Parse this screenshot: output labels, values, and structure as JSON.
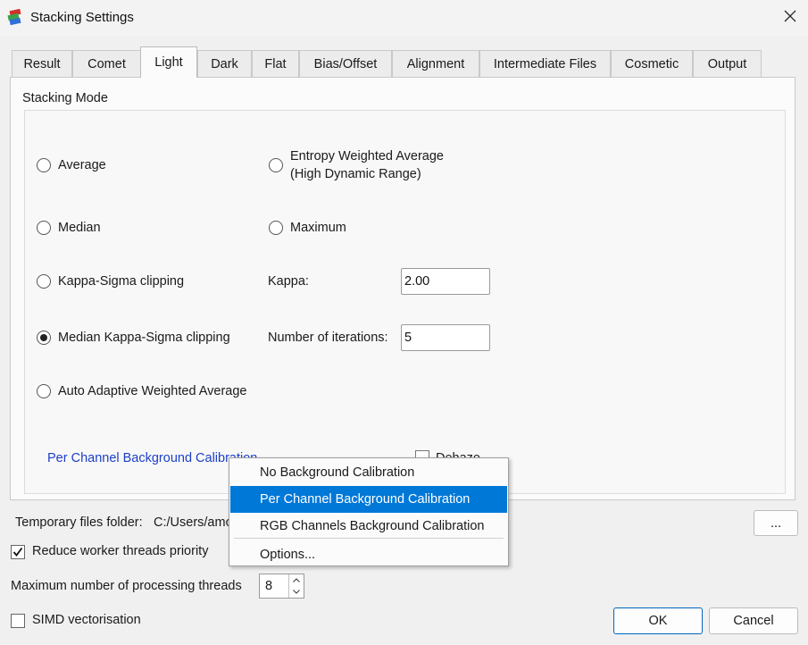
{
  "window": {
    "title": "Stacking Settings"
  },
  "tabs": [
    {
      "label": "Result"
    },
    {
      "label": "Comet"
    },
    {
      "label": "Light"
    },
    {
      "label": "Dark"
    },
    {
      "label": "Flat"
    },
    {
      "label": "Bias/Offset"
    },
    {
      "label": "Alignment"
    },
    {
      "label": "Intermediate Files"
    },
    {
      "label": "Cosmetic"
    },
    {
      "label": "Output"
    }
  ],
  "active_tab": "Light",
  "panel": {
    "stacking_mode_label": "Stacking Mode",
    "modes": {
      "average": "Average",
      "entropy_line1": "Entropy Weighted Average",
      "entropy_line2": "(High Dynamic Range)",
      "median": "Median",
      "maximum": "Maximum",
      "kappa_sigma": "Kappa-Sigma clipping",
      "median_kappa_sigma": "Median Kappa-Sigma clipping",
      "auto_adaptive": "Auto Adaptive Weighted Average"
    },
    "selected_mode": "Median Kappa-Sigma clipping",
    "kappa_label": "Kappa:",
    "kappa_value": "2.00",
    "iterations_label": "Number of iterations:",
    "iterations_value": "5",
    "background_calibration_link": "Per Channel Background Calibration",
    "dehaze_label": "Dehaze"
  },
  "context_menu": {
    "items": [
      {
        "label": "No Background Calibration"
      },
      {
        "label": "Per Channel Background Calibration",
        "highlighted": true
      },
      {
        "label": "RGB Channels Background Calibration"
      },
      {
        "label": "Options..."
      }
    ]
  },
  "bottom": {
    "temp_folder_label": "Temporary files folder:",
    "temp_folder_value": "C:/Users/amo",
    "browse_button": "...",
    "reduce_priority_label": "Reduce worker threads priority",
    "reduce_priority_checked": true,
    "max_threads_label": "Maximum number of processing threads",
    "max_threads_value": "8",
    "simd_label": "SIMD vectorisation",
    "simd_checked": false,
    "ok_button": "OK",
    "cancel_button": "Cancel"
  },
  "colors": {
    "accent": "#0078d7",
    "link": "#1d3fc7",
    "ok_border": "#0067c0"
  }
}
